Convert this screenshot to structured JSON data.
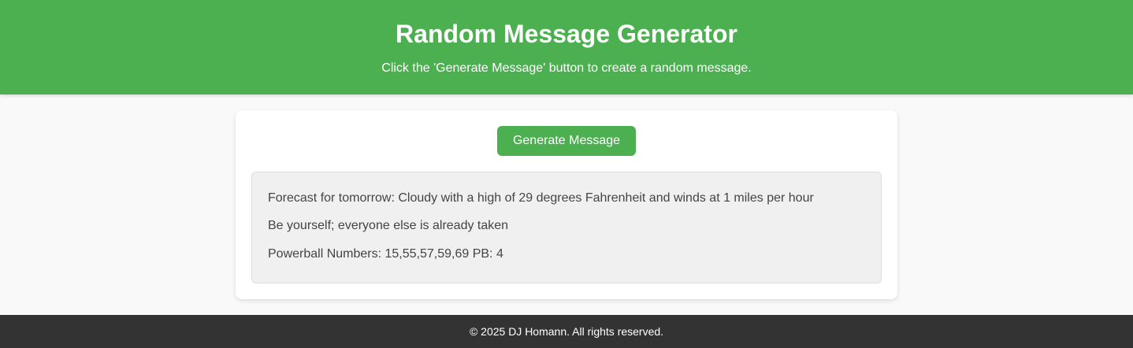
{
  "header": {
    "title": "Random Message Generator",
    "subtitle": "Click the 'Generate Message' button to create a random message."
  },
  "main": {
    "generate_label": "Generate Message",
    "messages": [
      "Forecast for tomorrow: Cloudy with a high of 29 degrees Fahrenheit and winds at 1 miles per hour",
      "Be yourself; everyone else is already taken",
      "Powerball Numbers: 15,55,57,59,69 PB: 4"
    ]
  },
  "footer": {
    "text": "© 2025 DJ Homann. All rights reserved."
  },
  "colors": {
    "accent": "#4caf50",
    "footer_bg": "#333333",
    "page_bg": "#f9f9f9",
    "message_box_bg": "#f0f0f0"
  }
}
